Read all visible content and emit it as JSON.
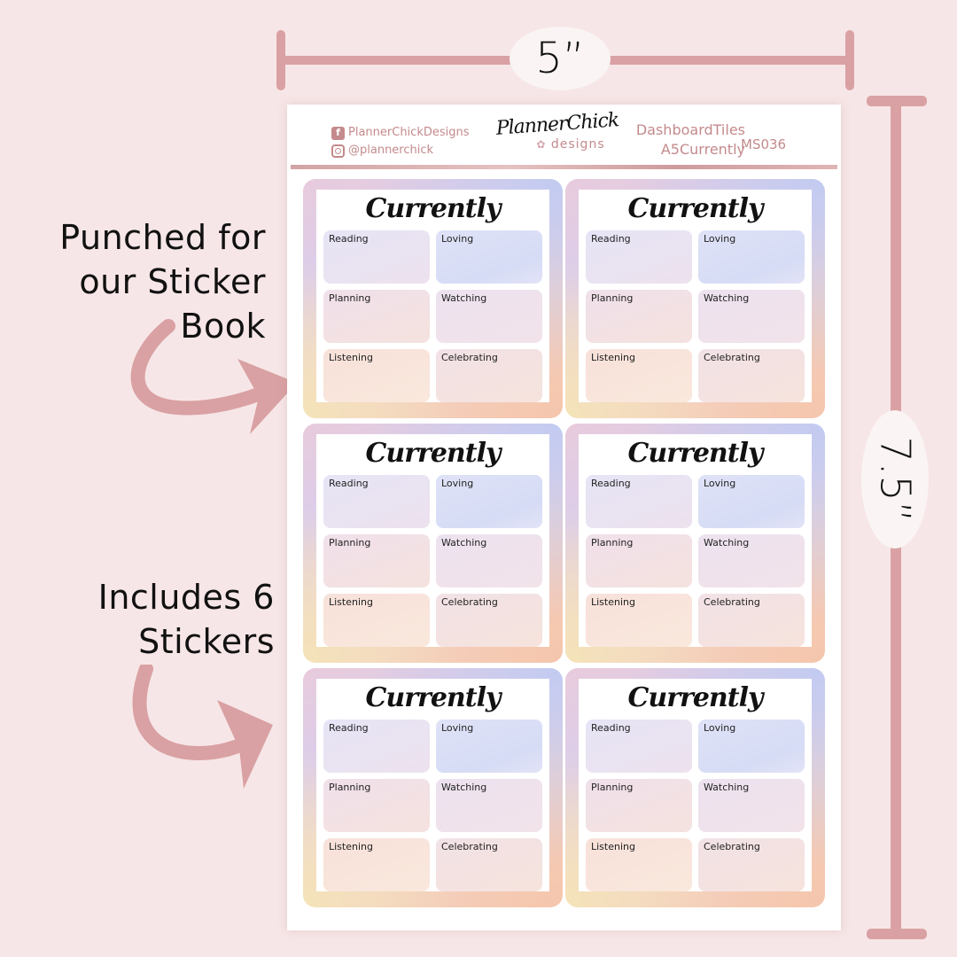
{
  "dimensions": {
    "width_label": "5”",
    "height_label": "7.5”"
  },
  "callouts": [
    {
      "lines": [
        "Punched for",
        "our Sticker",
        "Book"
      ]
    },
    {
      "lines": [
        "Includes 6",
        "Stickers"
      ]
    }
  ],
  "colors": {
    "background": "#f7e6e7",
    "accent": "#d9a1a3",
    "brand_text": "#c48a8c"
  },
  "sheet": {
    "header": {
      "facebook_handle": "PlannerChickDesigns",
      "instagram_handle": "@plannerchick",
      "logo_main": "PlannerChick",
      "logo_sub": "designs",
      "product_line1": "DashboardTiles",
      "product_line2": "A5Currently",
      "product_code": "MS036"
    },
    "tile_title": "Currently",
    "tile_fields": [
      "Reading",
      "Loving",
      "Planning",
      "Watching",
      "Listening",
      "Celebrating"
    ],
    "tile_count": 6
  }
}
